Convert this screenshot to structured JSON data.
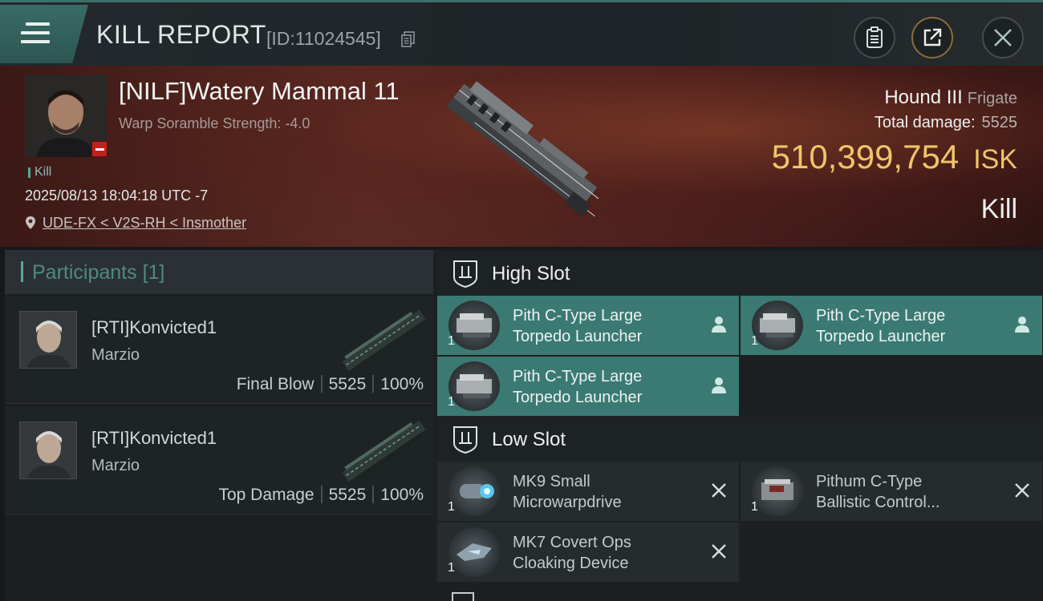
{
  "header": {
    "title": "KILL REPORT",
    "report_id": "[ID:11024545]",
    "menu_icon": "hamburger-icon",
    "copy_icon": "copy-icon",
    "clipboard_icon": "clipboard-icon",
    "share_icon": "share-icon",
    "close_icon": "close-icon"
  },
  "victim": {
    "name": "[NILF]Watery Mammal 11",
    "warp_scramble": "Warp Soramble Strength: -4.0",
    "tag": "Kill",
    "timestamp": "2025/08/13 18:04:18 UTC -7",
    "location": "UDE-FX < V2S-RH < Insmother",
    "ship": "Hound III",
    "ship_class": "Frigate",
    "total_damage_label": "Total damage:",
    "total_damage": "5525",
    "isk_value": "510,399,754",
    "isk_unit": "ISK",
    "result": "Kill"
  },
  "participants": {
    "title": "Participants",
    "count": "[1]",
    "rows": [
      {
        "name": "[RTI]Konvicted1",
        "corp": "Marzio",
        "role": "Final Blow",
        "damage": "5525",
        "percent": "100%"
      },
      {
        "name": "[RTI]Konvicted1",
        "corp": "Marzio",
        "role": "Top Damage",
        "damage": "5525",
        "percent": "100%"
      }
    ]
  },
  "fitting": {
    "high_slot_label": "High Slot",
    "low_slot_label": "Low Slot",
    "high_modules": [
      {
        "line1": "Pith C-Type Large",
        "line2": "Torpedo Launcher",
        "qty": "1",
        "status": "fitted"
      },
      {
        "line1": "Pith C-Type Large",
        "line2": "Torpedo Launcher",
        "qty": "1",
        "status": "fitted"
      },
      {
        "line1": "Pith C-Type Large",
        "line2": "Torpedo Launcher",
        "qty": "1",
        "status": "fitted"
      }
    ],
    "low_modules": [
      {
        "line1": "MK9 Small",
        "line2": "Microwarpdrive",
        "qty": "1",
        "status": "destroyed"
      },
      {
        "line1": "Pithum C-Type",
        "line2": "Ballistic Control...",
        "qty": "1",
        "status": "destroyed"
      },
      {
        "line1": "MK7 Covert Ops",
        "line2": "Cloaking Device",
        "qty": "1",
        "status": "destroyed"
      }
    ]
  },
  "colors": {
    "accent": "#58a597",
    "isk": "#f0c46a",
    "fitted_bg": "#3a7a72",
    "banner": "#5a2a22"
  }
}
